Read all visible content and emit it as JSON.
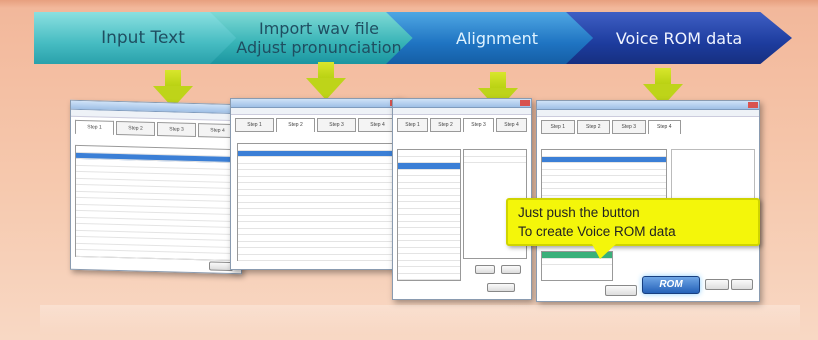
{
  "banner": {
    "step1": "Input Text",
    "step2_line1": "Import wav file",
    "step2_line2": "Adjust pronunciation",
    "step3": "Alignment",
    "step4": "Voice ROM data"
  },
  "callout": {
    "line1": "Just push the button",
    "line2": "To create Voice ROM data"
  },
  "rom_button": "ROM",
  "step_tabs": [
    "Step 1",
    "Step 2",
    "Step 3",
    "Step 4"
  ],
  "colors": {
    "background": "#f4c3a7",
    "arrow": "#bed419",
    "callout": "#f4f60a",
    "chevron_dark": "#1d3c9e"
  }
}
